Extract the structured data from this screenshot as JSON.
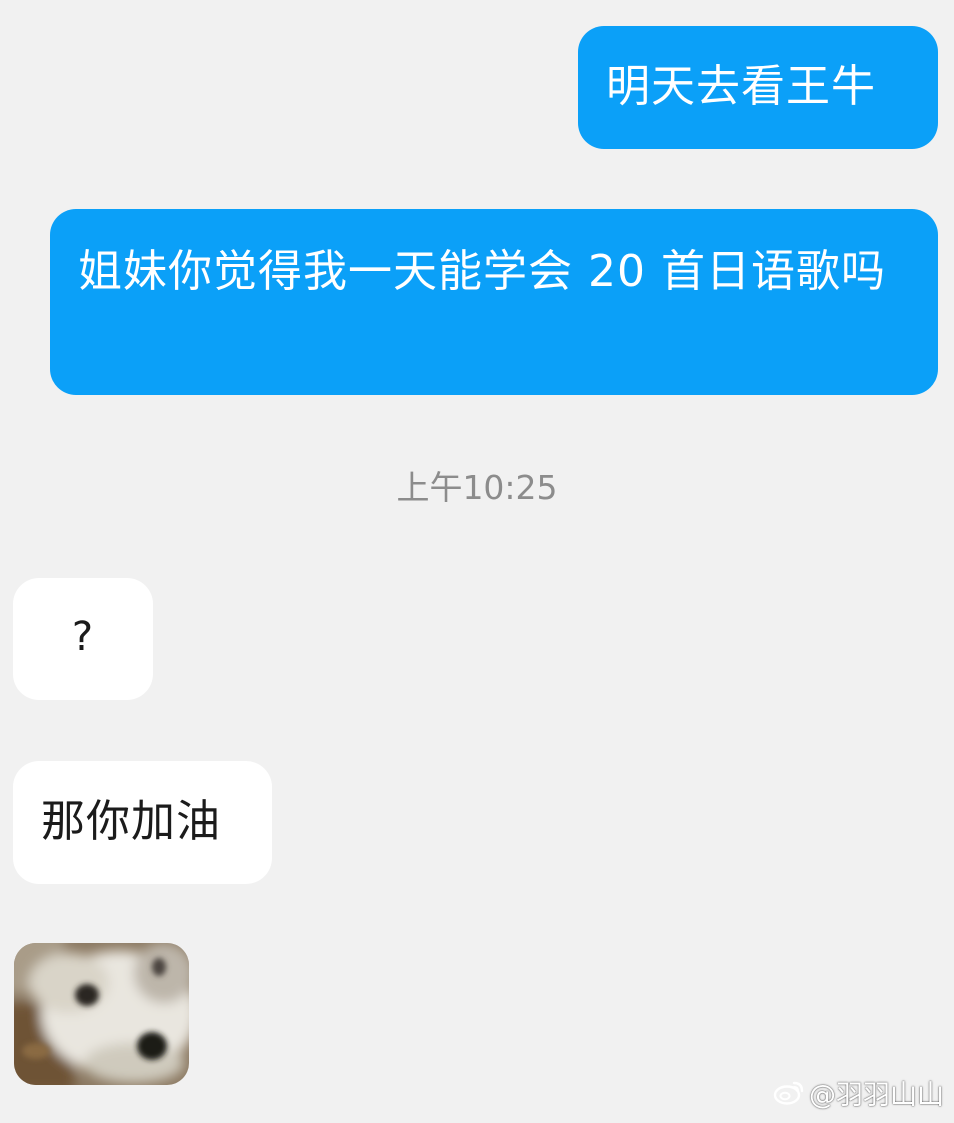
{
  "chat": {
    "messages": [
      {
        "direction": "outgoing",
        "text": "明天去看王牛"
      },
      {
        "direction": "outgoing",
        "text": "姐妹你觉得我一天能学会 20 首日语歌吗"
      },
      {
        "direction": "incoming",
        "text": "?"
      },
      {
        "direction": "incoming",
        "text": "那你加油"
      },
      {
        "direction": "incoming",
        "type": "sticker",
        "icon": "dog-face-sticker"
      }
    ],
    "timestamp": "上午10:25"
  },
  "watermark": {
    "icon": "weibo-logo-icon",
    "text": "@羽羽山山"
  },
  "colors": {
    "background": "#f1f1f1",
    "outgoing_bubble": "#0ba0f8",
    "incoming_bubble": "#ffffff",
    "timestamp_text": "#8c8c8c"
  }
}
